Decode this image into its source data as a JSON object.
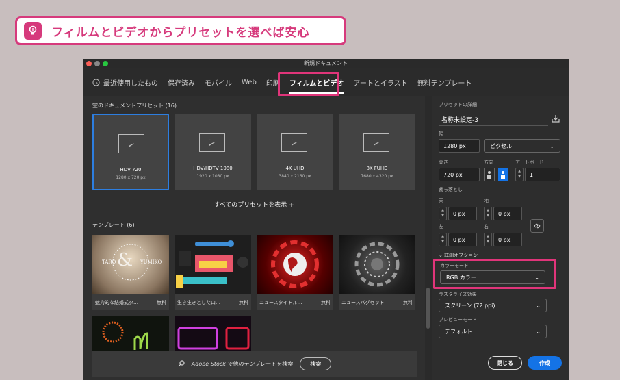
{
  "banner": {
    "text": "フィルムとビデオからプリセットを選べば安心"
  },
  "window": {
    "title": "新規ドキュメント"
  },
  "tabs": [
    "最近使用したもの",
    "保存済み",
    "モバイル",
    "Web",
    "印刷",
    "フィルムとビデオ",
    "アートとイラスト",
    "無料テンプレート"
  ],
  "presets_header": "空のドキュメントプリセット",
  "presets_count": "(16)",
  "presets": [
    {
      "name": "HDV 720",
      "size": "1280 x 720 px"
    },
    {
      "name": "HDV/HDTV 1080",
      "size": "1920 x 1080 px"
    },
    {
      "name": "4K UHD",
      "size": "3840 x 2160 px"
    },
    {
      "name": "8K FUHD",
      "size": "7680 x 4320 px"
    }
  ],
  "show_all": "すべてのプリセットを表示 +",
  "templates_header": "テンプレート",
  "templates_count": "(6)",
  "templates": [
    {
      "title": "魅力的な結婚式タ…",
      "price": "無料",
      "image_text_1": "TARO",
      "image_text_2": "YUMIKO",
      "ampersand": "&"
    },
    {
      "title": "生き生きとした口…",
      "price": "無料"
    },
    {
      "title": "ニュースタイトル…",
      "price": "無料"
    },
    {
      "title": "ニュースバグセット",
      "price": "無料"
    }
  ],
  "search": {
    "brand": "Adobe Stock",
    "text": " で他のテンプレートを検索",
    "button": "検索"
  },
  "details": {
    "header": "プリセットの詳細",
    "name": "名称未設定-3",
    "width_label": "幅",
    "width_value": "1280 px",
    "unit": "ピクセル",
    "height_label": "高さ",
    "height_value": "720 px",
    "orientation_label": "方向",
    "artboard_label": "アートボード",
    "artboard_value": "1",
    "bleed_label": "裁ち落とし",
    "top_label": "天",
    "top_value": "0 px",
    "bottom_label": "地",
    "bottom_value": "0 px",
    "left_label": "左",
    "left_value": "0 px",
    "right_label": "右",
    "right_value": "0 px",
    "advanced_label": "詳細オプション",
    "color_mode_label": "カラーモード",
    "color_mode_value": "RGB カラー",
    "raster_label": "ラスタライズ効果",
    "raster_value": "スクリーン (72 ppi)",
    "preview_label": "プレビューモード",
    "preview_value": "デフォルト"
  },
  "buttons": {
    "close": "閉じる",
    "create": "作成"
  },
  "colors": {
    "accent": "#e0357a",
    "primary": "#1473e6",
    "selection": "#2d7ee0"
  }
}
